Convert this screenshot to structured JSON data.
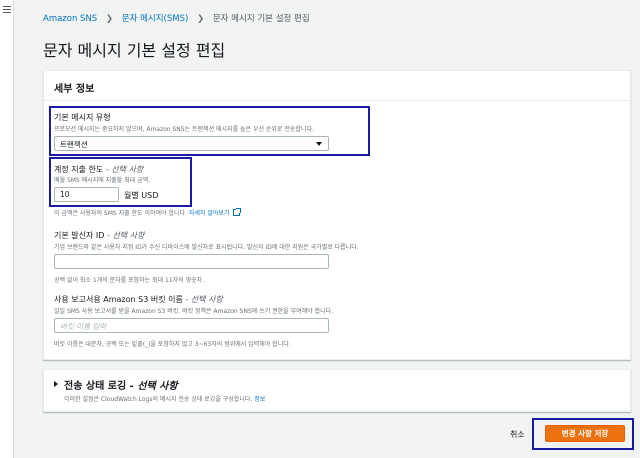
{
  "nav": {
    "menu_icon": "hamburger-menu-icon"
  },
  "breadcrumb": {
    "items": [
      "Amazon SNS",
      "문자 메시지(SMS)",
      "문자 메시지 기본 설정 편집"
    ],
    "separator_icon": "chevron-right-icon"
  },
  "page": {
    "title": "문자 메시지 기본 설정 편집"
  },
  "details": {
    "header": "세부 정보",
    "message_type": {
      "label": "기본 메시지 유형",
      "description": "프로모션 메시지는 중요하지 않으며, Amazon SNS는 트랜잭션 메시지를 높은 우선 순위로 전송합니다.",
      "value": "트랜잭션"
    },
    "spend_limit": {
      "label": "계정 지출 한도",
      "optional": " - 선택 사항",
      "description": "매월 SMS 메시지에 지출할 최대 금액.",
      "value": "10",
      "unit": "월별 USD",
      "hint": "이 금액은 사용자의 SMS 지출 한도 이하여야 합니다.",
      "link": "자세히 알아보기"
    },
    "sender_id": {
      "label": "기본 발신자 ID",
      "optional": " - 선택 사항",
      "description": "기업 브랜드와 같은 사용자 지정 ID가 수신 디바이스에 발신자로 표시됩니다. 발신자 ID에 대한 지원은 국가별로 다릅니다.",
      "value": "",
      "hint": "공백 없이 최소 1개의 문자를 포함하는 최대 11자의 영숫자."
    },
    "s3_bucket": {
      "label": "사용 보고서용 Amazon S3 버킷 이름",
      "optional": " - 선택 사항",
      "description": "일일 SMS 사용 보고서를 받을 Amazon S3 버킷. 버킷 정책은 Amazon SNS에 쓰기 권한을 부여해야 합니다.",
      "placeholder": "버킷 이름 입력",
      "hint": "버킷 이름은 대문자, 공백 또는 밑줄(_)을 포함하지 않고 3~63자의 범위에서 입력해야 합니다."
    }
  },
  "logging": {
    "title": "전송 상태 로깅",
    "optional": " - 선택 사항",
    "description": "이러한 설정은 CloudWatch Logs의 메시지 전송 상태 로깅을 구성합니다.",
    "info": "정보"
  },
  "actions": {
    "cancel": "취소",
    "save": "변경 사항 저장"
  },
  "colors": {
    "primary": "#ec7211",
    "link": "#0073bb",
    "highlight": "#1a1aa6"
  }
}
